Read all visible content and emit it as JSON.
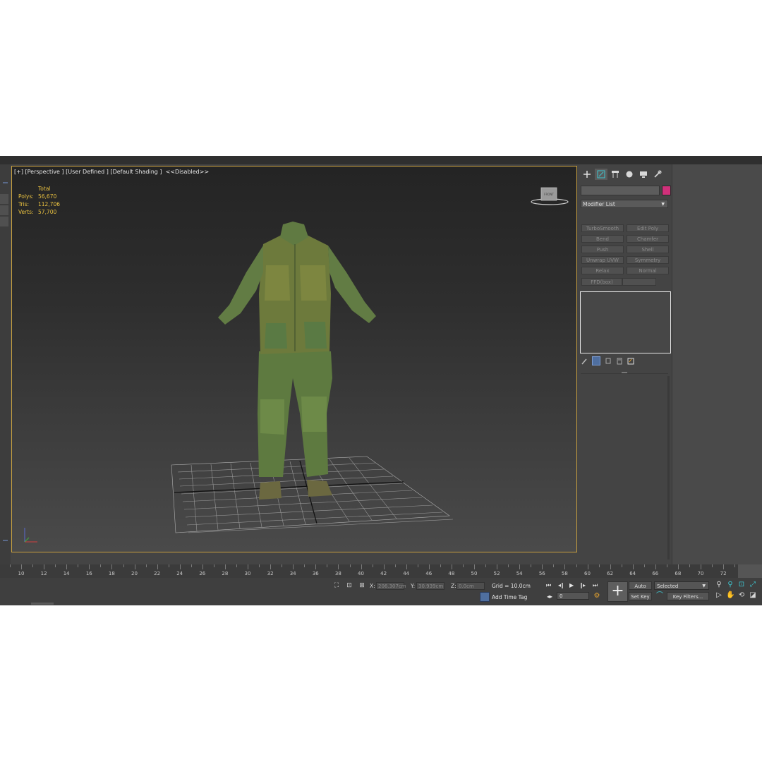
{
  "viewport": {
    "label": "[+] [Perspective ] [User Defined ] [Default Shading ]  <<Disabled>>",
    "viewcube_label": "FRONT",
    "stats": {
      "header": "Total",
      "rows": [
        {
          "key": "Polys:",
          "value": "56,670"
        },
        {
          "key": "Tris:",
          "value": "112,706"
        },
        {
          "key": "Verts:",
          "value": "57,700"
        }
      ]
    }
  },
  "command_panel": {
    "tabs": [
      "create-icon",
      "modify-icon",
      "hierarchy-icon",
      "motion-icon",
      "display-icon",
      "utilities-icon"
    ],
    "object_color": "#d0307a",
    "modifier_list_label": "Modifier List",
    "modifier_buttons": [
      "TurboSmooth",
      "Edit Poly",
      "Bend",
      "Chamfer",
      "Push",
      "Shell",
      "Unwrap UVW",
      "Symmetry",
      "Relax",
      "Normal",
      "FFD(box)",
      ""
    ]
  },
  "timeline": {
    "ticks": [
      "10",
      "12",
      "14",
      "16",
      "18",
      "20",
      "22",
      "24",
      "26",
      "28",
      "30",
      "32",
      "34",
      "36",
      "38",
      "40",
      "42",
      "44",
      "46",
      "48",
      "50",
      "52",
      "54",
      "56",
      "58",
      "60",
      "62",
      "64",
      "66",
      "68",
      "70",
      "72"
    ]
  },
  "status": {
    "x_label": "X:",
    "x_value": "206.307cm",
    "y_label": "Y:",
    "y_value": "30.939cm",
    "z_label": "Z:",
    "z_value": "0.0cm",
    "grid": "Grid = 10.0cm",
    "add_time_tag": "Add Time Tag",
    "current_frame": "0",
    "auto_key": "Auto Key",
    "set_key": "Set Key",
    "selection_mode": "Selected",
    "key_filters": "Key Filters..."
  }
}
